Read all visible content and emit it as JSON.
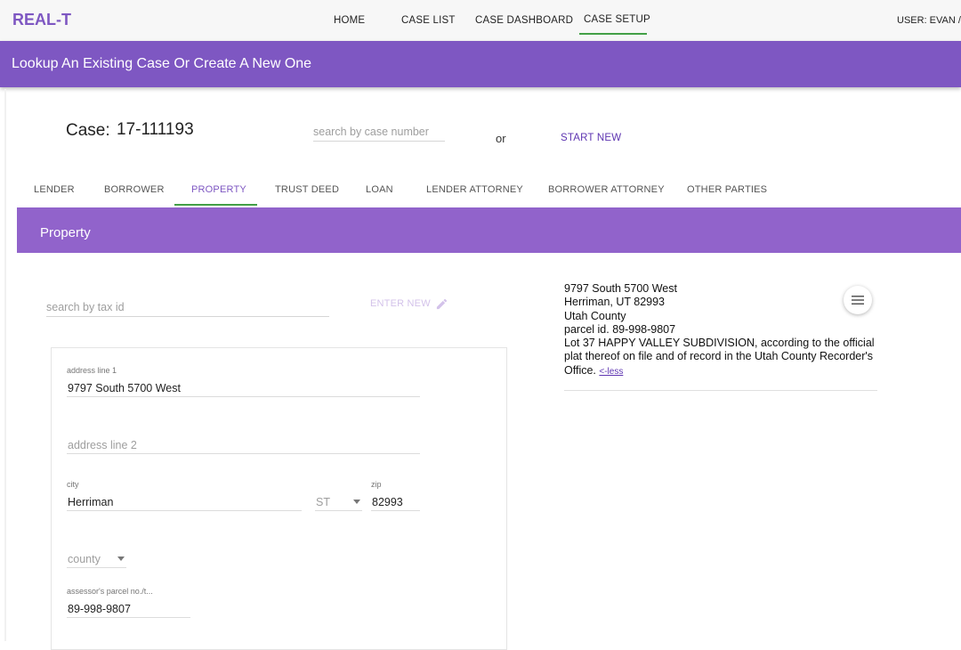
{
  "app": {
    "brand": "REAL-T",
    "user": "USER: EVAN /"
  },
  "nav": {
    "items": [
      {
        "label": "HOME"
      },
      {
        "label": "CASE LIST"
      },
      {
        "label": "CASE DASHBOARD"
      },
      {
        "label": "CASE SETUP"
      }
    ],
    "active": "CASE SETUP"
  },
  "page": {
    "title": "Lookup An Existing Case Or Create A New One"
  },
  "case": {
    "label": "Case:",
    "number": "17-111193",
    "search_placeholder": "search by case number",
    "or_text": "or",
    "start_new": "START NEW"
  },
  "tabs": {
    "items": [
      {
        "label": "LENDER"
      },
      {
        "label": "BORROWER"
      },
      {
        "label": "PROPERTY"
      },
      {
        "label": "TRUST DEED"
      },
      {
        "label": "LOAN"
      },
      {
        "label": "LENDER ATTORNEY"
      },
      {
        "label": "BORROWER ATTORNEY"
      },
      {
        "label": "OTHER PARTIES"
      }
    ],
    "active": "PROPERTY"
  },
  "section": {
    "title": "Property",
    "tax_search_placeholder": "search by tax id",
    "enter_new": "ENTER NEW"
  },
  "form": {
    "address1": {
      "label": "address line 1",
      "value": "9797 South 5700 West"
    },
    "address2": {
      "placeholder": "address line 2",
      "value": ""
    },
    "city": {
      "label": "city",
      "value": "Herriman"
    },
    "state": {
      "placeholder": "ST"
    },
    "zip": {
      "label": "zip",
      "value": "82993"
    },
    "county": {
      "placeholder": "county"
    },
    "parcel": {
      "label": "assessor's parcel no./t...",
      "value": "89-998-9807"
    }
  },
  "summary": {
    "line1": "9797 South 5700 West",
    "line2": "Herriman, UT 82993",
    "line3": "Utah County",
    "line4": "parcel id. 89-998-9807",
    "legal": "Lot 37 HAPPY VALLEY SUBDIVISION, according to the official plat thereof on file and of record in the Utah County Recorder's Office.",
    "less_link": "<-less"
  },
  "colors": {
    "brand": "#7e57c2",
    "header_bar": "#7e57c2",
    "section_bar": "#9163cb",
    "active_underline": "#43a047",
    "link": "#5e35b1"
  },
  "icons": {
    "enter_new": "pencil-icon",
    "summary_menu": "menu-icon"
  }
}
